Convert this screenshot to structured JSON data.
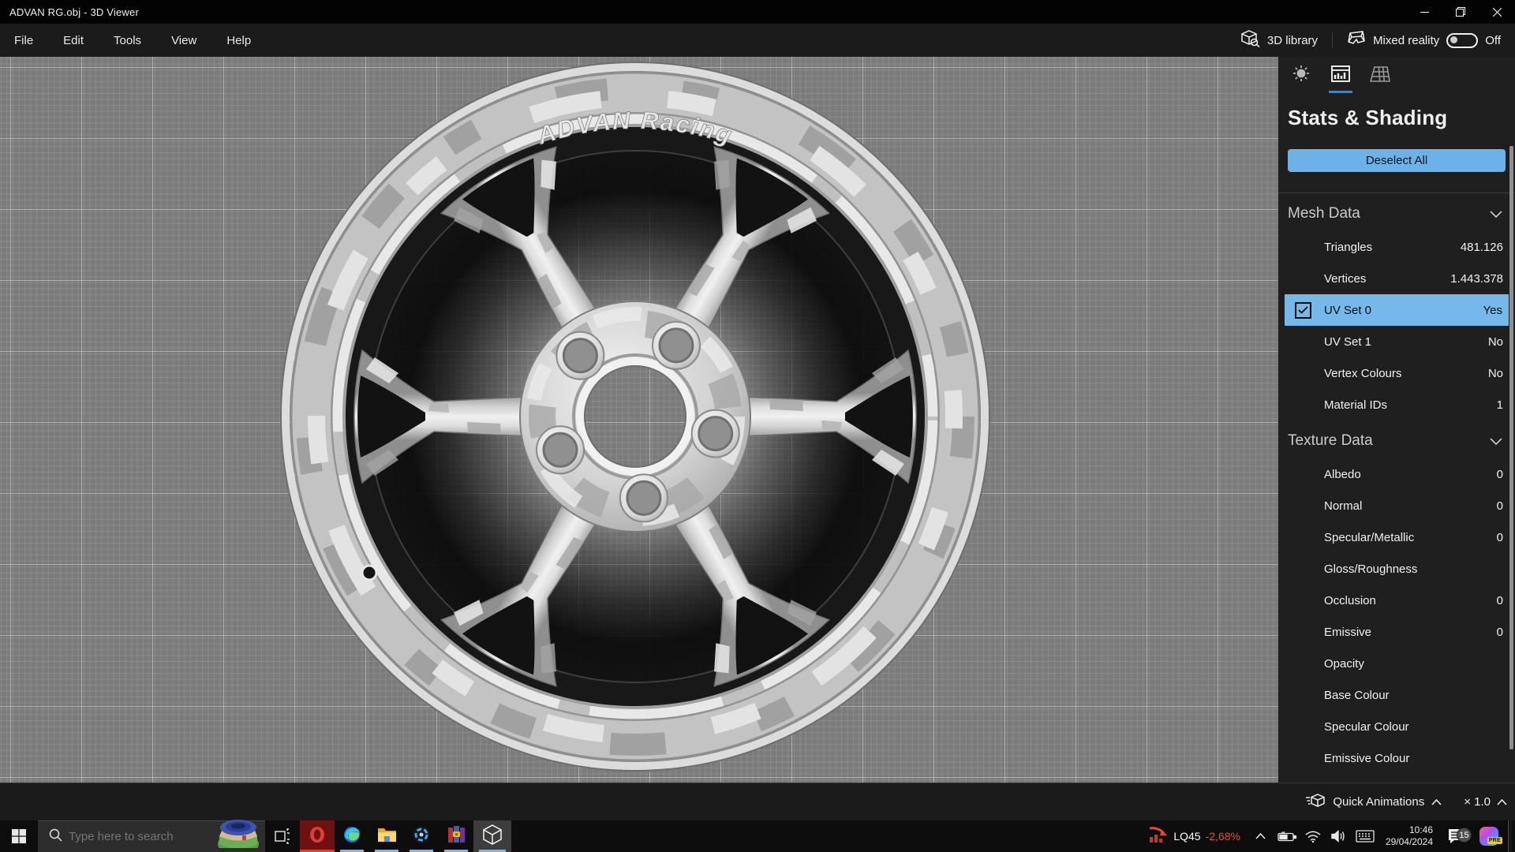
{
  "window": {
    "title": "ADVAN RG.obj - 3D Viewer"
  },
  "menu": {
    "items": [
      "File",
      "Edit",
      "Tools",
      "View",
      "Help"
    ]
  },
  "top_actions": {
    "library_label": "3D library",
    "mixed_reality_label": "Mixed reality",
    "mixed_reality_state": "Off"
  },
  "viewport": {
    "wheel_label": "ADVAN Racing"
  },
  "panel": {
    "title": "Stats & Shading",
    "deselect_button": "Deselect All",
    "tabs": [
      "environment",
      "stats",
      "grid"
    ],
    "sections": [
      {
        "title": "Mesh Data",
        "rows": [
          {
            "label": "Triangles",
            "value": "481.126"
          },
          {
            "label": "Vertices",
            "value": "1.443.378"
          },
          {
            "label": "UV Set 0",
            "value": "Yes"
          },
          {
            "label": "UV Set 1",
            "value": "No"
          },
          {
            "label": "Vertex Colours",
            "value": "No"
          },
          {
            "label": "Material IDs",
            "value": "1"
          }
        ]
      },
      {
        "title": "Texture Data",
        "rows": [
          {
            "label": "Albedo",
            "value": "0"
          },
          {
            "label": "Normal",
            "value": "0"
          },
          {
            "label": "Specular/Metallic",
            "value": "0"
          },
          {
            "label": "Gloss/Roughness",
            "value": ""
          },
          {
            "label": "Occlusion",
            "value": "0"
          },
          {
            "label": "Emissive",
            "value": "0"
          },
          {
            "label": "Opacity",
            "value": ""
          },
          {
            "label": "Base Colour",
            "value": ""
          },
          {
            "label": "Specular Colour",
            "value": ""
          },
          {
            "label": "Emissive Colour",
            "value": ""
          }
        ]
      }
    ]
  },
  "bottom_bar": {
    "quick_animations": "Quick Animations",
    "speed": "× 1.0"
  },
  "taskbar": {
    "search_placeholder": "Type here to search",
    "tray": {
      "stock_symbol": "LQ45",
      "stock_change": "-2,68%",
      "time": "10:46",
      "date": "29/04/2024",
      "notification_count": "15",
      "copilot_badge": "PRE"
    }
  },
  "colors": {
    "accent": "#1e8ee6",
    "selection": "#74b9ea",
    "button": "#6cb2e8",
    "running": "#76b9ed",
    "opera-red": "#e23b3b",
    "negative": "#e05050"
  }
}
